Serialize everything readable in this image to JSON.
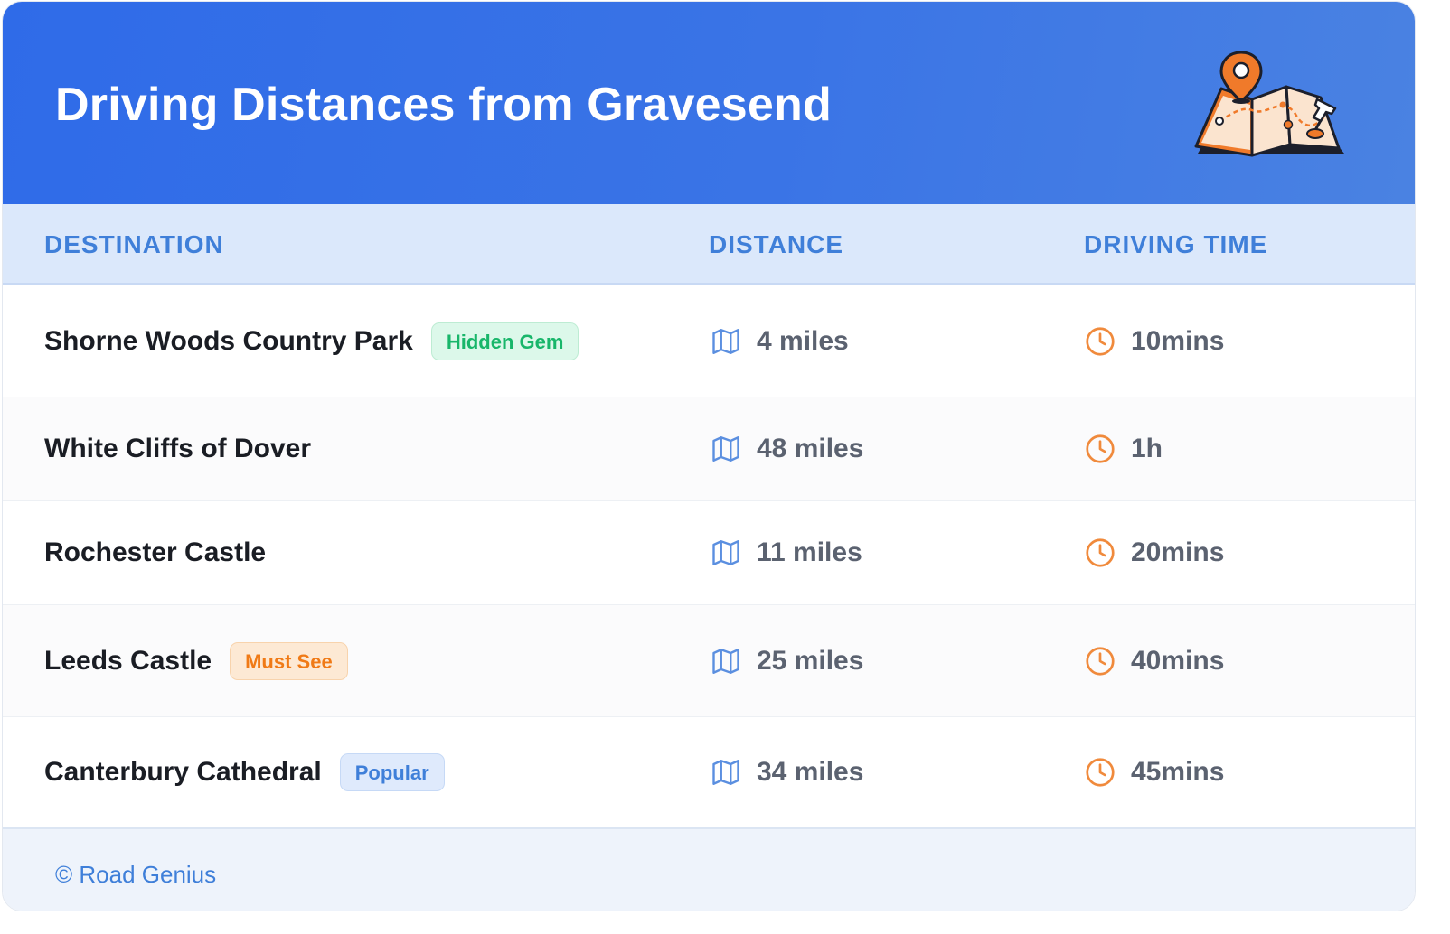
{
  "header": {
    "title": "Driving Distances from Gravesend",
    "illustration_icon": "folded-map-with-pins-icon"
  },
  "table": {
    "columns": {
      "destination": "DESTINATION",
      "distance": "DISTANCE",
      "driving_time": "DRIVING TIME"
    },
    "rows": [
      {
        "destination": "Shorne Woods Country Park",
        "badge": "Hidden Gem",
        "badge_color": "green",
        "distance": "4 miles",
        "time": "10mins"
      },
      {
        "destination": "White Cliffs of Dover",
        "badge": "",
        "badge_color": "",
        "distance": "48 miles",
        "time": "1h"
      },
      {
        "destination": "Rochester Castle",
        "badge": "",
        "badge_color": "",
        "distance": "11 miles",
        "time": "20mins"
      },
      {
        "destination": "Leeds Castle",
        "badge": "Must See",
        "badge_color": "orange",
        "distance": "25 miles",
        "time": "40mins"
      },
      {
        "destination": "Canterbury Cathedral",
        "badge": "Popular",
        "badge_color": "blue",
        "distance": "34 miles",
        "time": "45mins"
      }
    ],
    "distance_icon": "map-icon",
    "time_icon": "clock-icon"
  },
  "footer": {
    "credit": "© Road Genius"
  },
  "colors": {
    "header_gradient_start": "#2f6be8",
    "header_gradient_end": "#4a82e2",
    "column_header_bg": "#dbe8fb",
    "column_header_text": "#3f7fd9",
    "map_icon": "#5b8fe0",
    "clock_icon": "#f08a3c",
    "badge_green": "#18b66a",
    "badge_orange": "#f07a16",
    "badge_blue": "#3f7fd9"
  }
}
